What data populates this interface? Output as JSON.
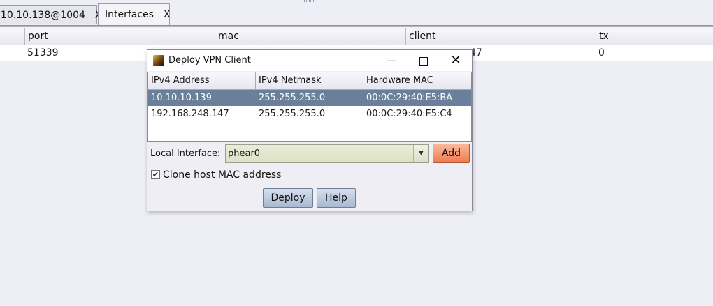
{
  "tabs": [
    {
      "label": "10.10.138@1004",
      "close": "X"
    },
    {
      "label": "Interfaces",
      "close": "X"
    }
  ],
  "background_table": {
    "columns": [
      "port",
      "mac",
      "client",
      "tx"
    ],
    "row": {
      "port": "51339",
      "mac_fragment": "",
      "client_fragment": "47",
      "tx": "0"
    }
  },
  "dialog": {
    "title": "Deploy VPN Client",
    "minimize_symbol": "—",
    "close_symbol": "✕",
    "table": {
      "columns": [
        "IPv4 Address",
        "IPv4 Netmask",
        "Hardware MAC"
      ],
      "rows": [
        {
          "ip": "10.10.10.139",
          "netmask": "255.255.255.0",
          "mac": "00:0C:29:40:E5:BA",
          "selected": true
        },
        {
          "ip": "192.168.248.147",
          "netmask": "255.255.255.0",
          "mac": "00:0C:29:40:E5:C4",
          "selected": false
        }
      ]
    },
    "local_interface_label": "Local Interface:",
    "local_interface_value": "phear0",
    "add_label": "Add",
    "clone_mac_label": "Clone host MAC address",
    "clone_mac_checked": true,
    "check_glyph": "✔",
    "dropdown_glyph": "▼",
    "deploy_label": "Deploy",
    "help_label": "Help"
  },
  "icons": {
    "app": "app-icon",
    "minimize": "minimize-icon",
    "maximize": "maximize-icon",
    "close": "close-icon",
    "dropdown": "chevron-down-icon",
    "check": "checkmark-icon"
  },
  "colors": {
    "selected_row": "#6a7f99",
    "add_button": "#f07a4e",
    "combo_bg": "#dde2c4",
    "background": "#eeeef6"
  }
}
